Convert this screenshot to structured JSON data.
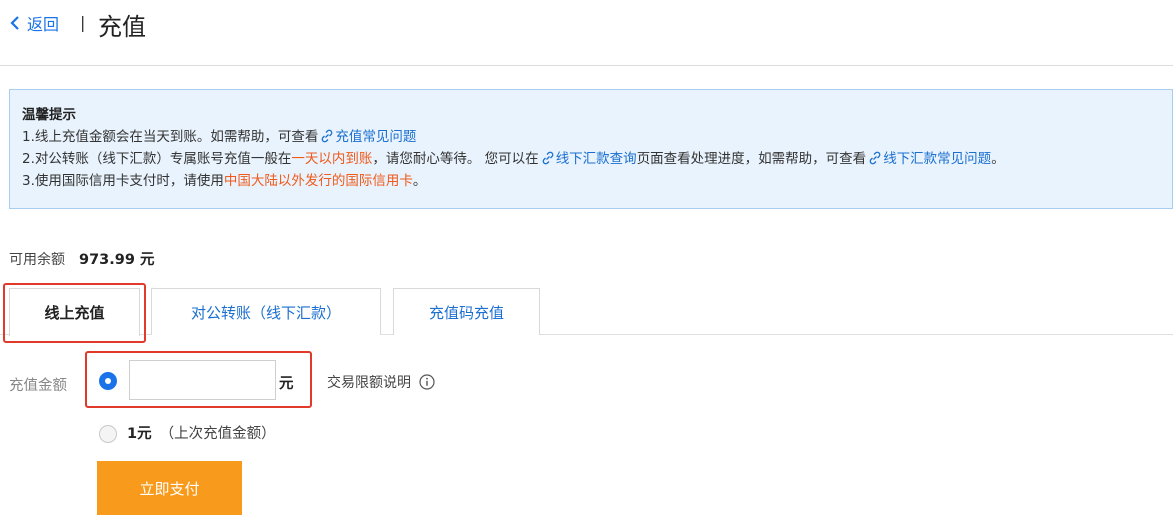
{
  "header": {
    "back_label": "返回",
    "separator": "|",
    "title": "充值"
  },
  "notice": {
    "title": "温馨提示",
    "line1": {
      "prefix": "1.线上充值金额会在当天到账。如需帮助，可查看",
      "link": "充值常见问题"
    },
    "line2": {
      "p1": "2.对公转账（线下汇款）专属账号充值一般在",
      "highlight": "一天以内到账",
      "p2": "，请您耐心等待。 您可以在",
      "link1": "线下汇款查询",
      "p3": "页面查看处理进度，如需帮助，可查看",
      "link2": "线下汇款常见问题",
      "p4": "。"
    },
    "line3": {
      "p1": "3.使用国际信用卡支付时，请使用",
      "highlight": "中国大陆以外发行的国际信用卡",
      "p2": "。"
    }
  },
  "balance": {
    "label": "可用余额",
    "amount": "973.99 元"
  },
  "tabs": [
    {
      "label": "线上充值",
      "active": true
    },
    {
      "label": "对公转账（线下汇款）",
      "active": false
    },
    {
      "label": "充值码充值",
      "active": false
    }
  ],
  "form": {
    "amount_label": "充值金额",
    "amount_value": "",
    "unit": "元",
    "limit_label": "交易限额说明",
    "last_amount_value": "1元",
    "last_amount_note": "（上次充值金额）",
    "pay_button": "立即支付"
  },
  "colors": {
    "link": "#1a6fd0",
    "highlight": "#f05a1a",
    "pay_button": "#f89a1c",
    "notice_bg": "#e9f3fd",
    "annotation_box": "#e23a2a"
  }
}
